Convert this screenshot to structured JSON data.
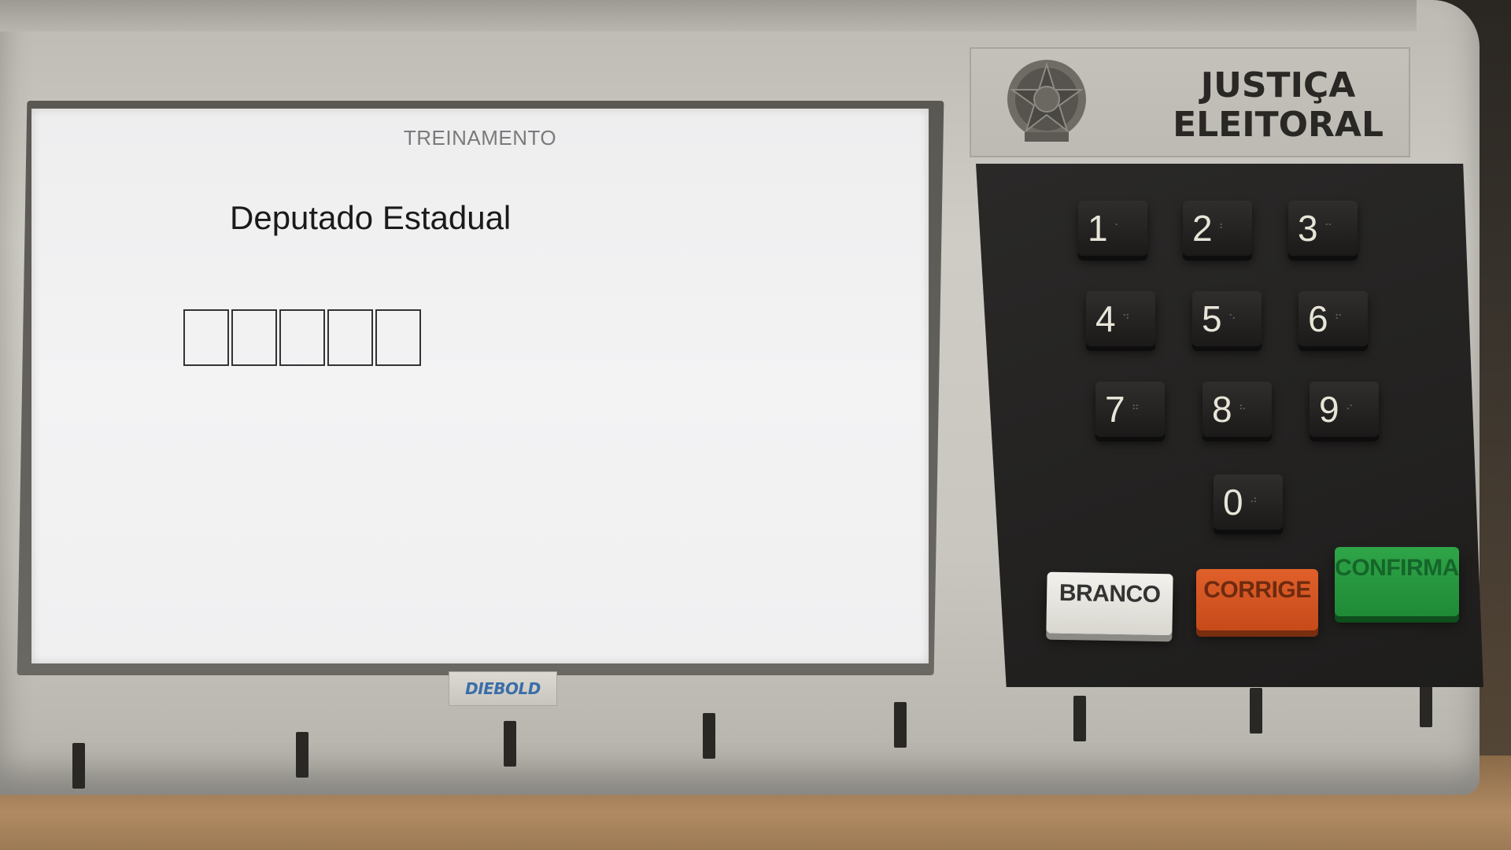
{
  "screen": {
    "mode_label": "TREINAMENTO",
    "office": "Deputado Estadual",
    "digit_slots": [
      "",
      "",
      "",
      "",
      ""
    ]
  },
  "header": {
    "line1": "JUSTIÇA",
    "line2": "ELEITORAL",
    "emblem": "coat-of-arms-emblem"
  },
  "brand": "DIEBOLD",
  "keypad": {
    "digits": [
      "1",
      "2",
      "3",
      "4",
      "5",
      "6",
      "7",
      "8",
      "9",
      "0"
    ],
    "branco": "BRANCO",
    "corrige": "CORRIGE",
    "confirma": "CONFIRMA"
  },
  "colors": {
    "branco": "#e8e6e0",
    "corrige": "#d4551f",
    "confirma": "#28983f",
    "keypad": "#222120"
  }
}
